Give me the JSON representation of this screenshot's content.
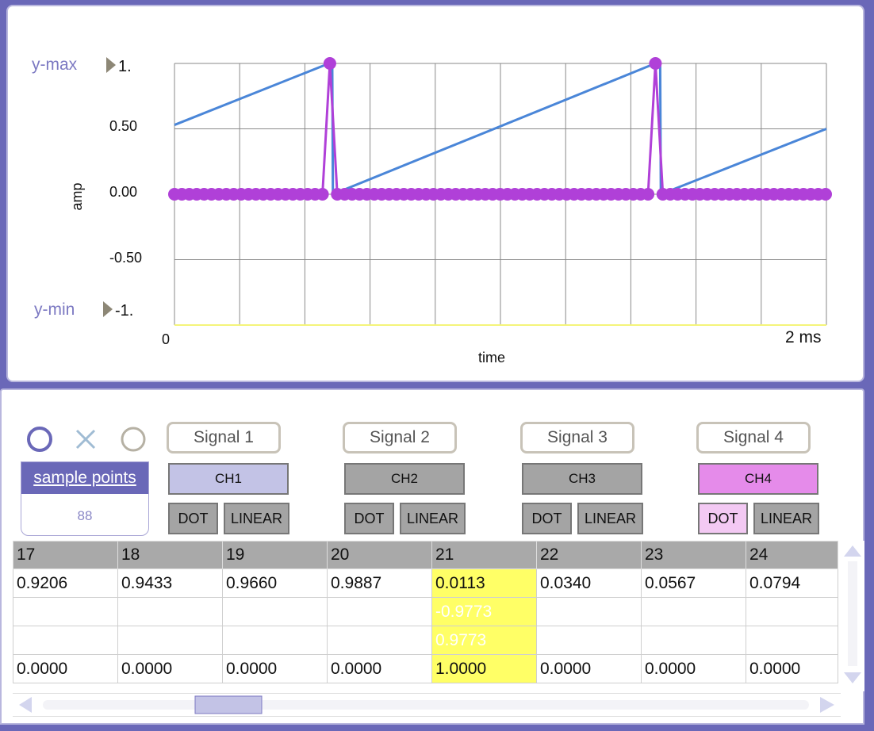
{
  "plot": {
    "ymax_label": "y-max",
    "ymin_label": "y-min",
    "ymax_value": "1.",
    "ymin_value": "-1.",
    "y_ticks": [
      "0.50",
      "0.00",
      "-0.50"
    ],
    "ylabel": "amp",
    "xlabel": "time",
    "x_start": "0",
    "x_end": "2 ms",
    "colors": {
      "sawtooth": "#4a86d8",
      "impulse": "#b040d8",
      "baseline": "#f4f47a",
      "grid": "#8a8a8a"
    }
  },
  "chart_data": {
    "type": "line",
    "xlabel": "time",
    "ylabel": "amp",
    "xlim": [
      0,
      2
    ],
    "ylim": [
      -1,
      1
    ],
    "grid": true,
    "series": [
      {
        "type": "line",
        "color": "#4a86d8",
        "x": [
          0,
          0.474,
          0.484,
          0.486,
          1.475,
          1.49,
          1.492,
          2.0
        ],
        "y": [
          0.53,
          1.0,
          1.0,
          0.0,
          1.0,
          1.0,
          0.0,
          0.5
        ]
      },
      {
        "type": "dots",
        "color": "#b040d8",
        "x_step": 0.0227,
        "count": 89,
        "impulse_indices": [
          21,
          65
        ],
        "impulse_value": 1.0
      }
    ]
  },
  "controls": {
    "icons": [
      "circle-icon",
      "x-icon",
      "circle-icon"
    ],
    "sample_points_label": "sample points",
    "sample_points_value": "88",
    "signals": [
      {
        "label": "Signal 1",
        "channel": "CH1",
        "ch_color": "#c3c3e6",
        "dot": "DOT",
        "linear": "LINEAR",
        "dot_color": "#a4a4a4"
      },
      {
        "label": "Signal 2",
        "channel": "CH2",
        "ch_color": "#a4a4a4",
        "dot": "DOT",
        "linear": "LINEAR",
        "dot_color": "#a4a4a4"
      },
      {
        "label": "Signal 3",
        "channel": "CH3",
        "ch_color": "#a4a4a4",
        "dot": "DOT",
        "linear": "LINEAR",
        "dot_color": "#a4a4a4"
      },
      {
        "label": "Signal 4",
        "channel": "CH4",
        "ch_color": "#e58bea",
        "dot": "DOT",
        "linear": "LINEAR",
        "dot_color": "#f3c9f3"
      }
    ]
  },
  "table": {
    "columns": [
      "17",
      "18",
      "19",
      "20",
      "21",
      "22",
      "23",
      "24"
    ],
    "rows": [
      [
        "0.9206",
        "0.9433",
        "0.9660",
        "0.9887",
        "0.0113",
        "0.0340",
        "0.0567",
        "0.0794"
      ],
      [
        "",
        "",
        "",
        "",
        "-0.9773",
        "",
        "",
        ""
      ],
      [
        "",
        "",
        "",
        "",
        "0.9773",
        "",
        "",
        ""
      ],
      [
        "0.0000",
        "0.0000",
        "0.0000",
        "0.0000",
        "1.0000",
        "0.0000",
        "0.0000",
        "0.0000"
      ]
    ],
    "highlight_column": 4
  }
}
